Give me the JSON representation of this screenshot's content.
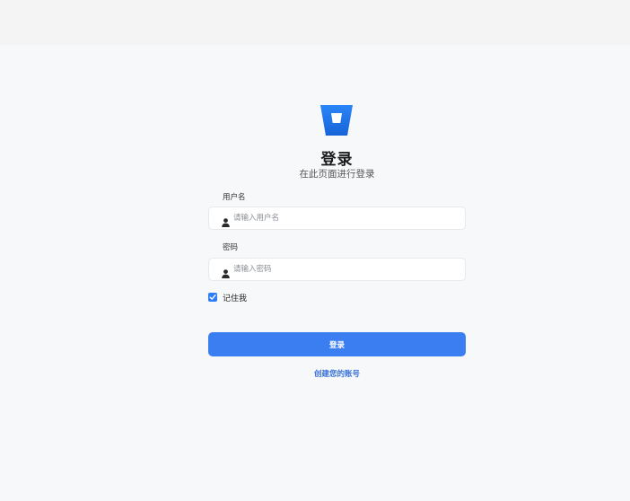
{
  "login": {
    "title": "登录",
    "subtitle": "在此页面进行登录",
    "username": {
      "label": "用户名",
      "placeholder": "请输入用户名",
      "value": ""
    },
    "password": {
      "label": "密码",
      "placeholder": "请输入密码",
      "value": ""
    },
    "remember_label": "记住我",
    "remember_checked": true,
    "submit_label": "登录",
    "create_account_label": "创建您的账号"
  },
  "colors": {
    "accent": "#3b7ef2",
    "link": "#3a72d8",
    "background": "#f6f8fa"
  },
  "icons": {
    "logo": "bucket-logo-icon",
    "user": "user-icon",
    "check": "checkmark-icon"
  }
}
